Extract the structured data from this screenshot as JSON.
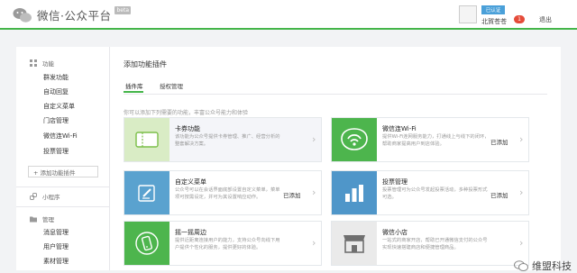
{
  "header": {
    "logo_text": "微信·公众平台",
    "logo_badge": "beta",
    "user": {
      "verified_label": "已认证",
      "name": "北賀苍苍",
      "notification_count": "1",
      "logout": "退出"
    }
  },
  "sidebar": {
    "groups": [
      {
        "title": "功能",
        "icon": "grid-icon",
        "items": [
          "群发功能",
          "自动回复",
          "自定义菜单",
          "门店管理",
          "微信连Wi-Fi",
          "投票管理"
        ]
      },
      {
        "title": "小程序",
        "icon": "link-icon",
        "items": []
      },
      {
        "title": "管理",
        "icon": "folder-icon",
        "items": [
          "消息管理",
          "用户管理",
          "素材管理"
        ]
      }
    ],
    "add_plugin": "+ 添加功能插件"
  },
  "main": {
    "title": "添加功能插件",
    "tabs": [
      {
        "label": "插件库",
        "active": true
      },
      {
        "label": "授权管理",
        "active": false
      }
    ],
    "hint": "你可以添加下列需要的功能，丰富公众号能力和体验",
    "cards": [
      {
        "name": "卡券功能",
        "desc": "该功能为公众号提供卡券管理、推广、经营分析的整套解决方案。",
        "status": "",
        "icon": "card-coupon-icon",
        "icon_bg": "#d9ecc5"
      },
      {
        "name": "微信连Wi-Fi",
        "desc": "提供Wi-Fi连网服务能力，打通线上与线下的闭环，帮助商家提高用户到店体验。",
        "status": "已添加",
        "icon": "wifi-icon",
        "icon_bg": "#4db54d"
      },
      {
        "name": "自定义菜单",
        "desc": "公众号可以在会话界面底部设置自定义菜单，菜单项可按需设定，并可为其设置响应动作。",
        "status": "已添加",
        "icon": "edit-menu-icon",
        "icon_bg": "#5aa2cf"
      },
      {
        "name": "投票管理",
        "desc": "投票管理可为公众号发起投票活动，多种投票形式可选。",
        "status": "已添加",
        "icon": "bar-chart-icon",
        "icon_bg": "#4f96c9"
      },
      {
        "name": "摇一摇周边",
        "desc": "提供近距离连接用户的能力，支持公众号向线下用户提供个性化的服务，提供更好的体验。",
        "status": "",
        "icon": "shake-phone-icon",
        "icon_bg": "#4db54d"
      },
      {
        "name": "微信小店",
        "desc": "一站式的商家开店，帮助已开通微信支付的公众号实现快速搭建商店和便捷管理商品。",
        "status": "",
        "icon": "store-icon",
        "icon_bg": "#eaeaea"
      }
    ]
  },
  "watermark": {
    "text": "维盟科技"
  },
  "colors": {
    "accent": "#44b549",
    "badge": "#e54b39",
    "verified": "#4aa0d9"
  }
}
